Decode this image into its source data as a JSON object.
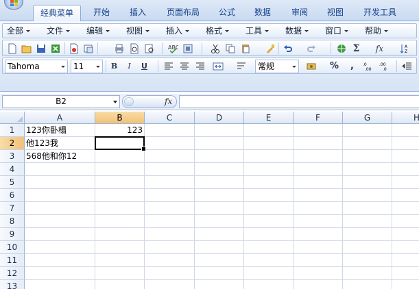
{
  "ribbon_tabs": [
    "经典菜单",
    "开始",
    "插入",
    "页面布局",
    "公式",
    "数据",
    "审阅",
    "视图",
    "开发工具"
  ],
  "active_tab": 0,
  "menus": [
    "全部",
    "文件",
    "编辑",
    "视图",
    "插入",
    "格式",
    "工具",
    "数据",
    "窗口",
    "帮助"
  ],
  "font": {
    "name": "Tahoma",
    "size": "11"
  },
  "number_format": "常规",
  "format_buttons": {
    "bold": "B",
    "italic": "I",
    "underline": "U",
    "percent": "%",
    "comma": ",",
    "sigma": "Σ",
    "fx": "fx"
  },
  "formula_bar": {
    "name_box": "B2",
    "fx_label": "fx",
    "formula": ""
  },
  "columns": [
    "A",
    "B",
    "C",
    "D",
    "E",
    "F",
    "G",
    "H"
  ],
  "selected_column": "B",
  "rows": [
    "1",
    "2",
    "3",
    "4",
    "5",
    "6",
    "7",
    "8",
    "9",
    "10",
    "11",
    "12",
    "13"
  ],
  "selected_row": "2",
  "cells": {
    "A1": "123你卧榻",
    "B1": "123",
    "A2": "他123我",
    "A3": "568他和你12"
  },
  "colors": {
    "selection_header": "#f2c178",
    "ribbon_blue": "#15428b",
    "grid_line": "#d0d7e5"
  }
}
